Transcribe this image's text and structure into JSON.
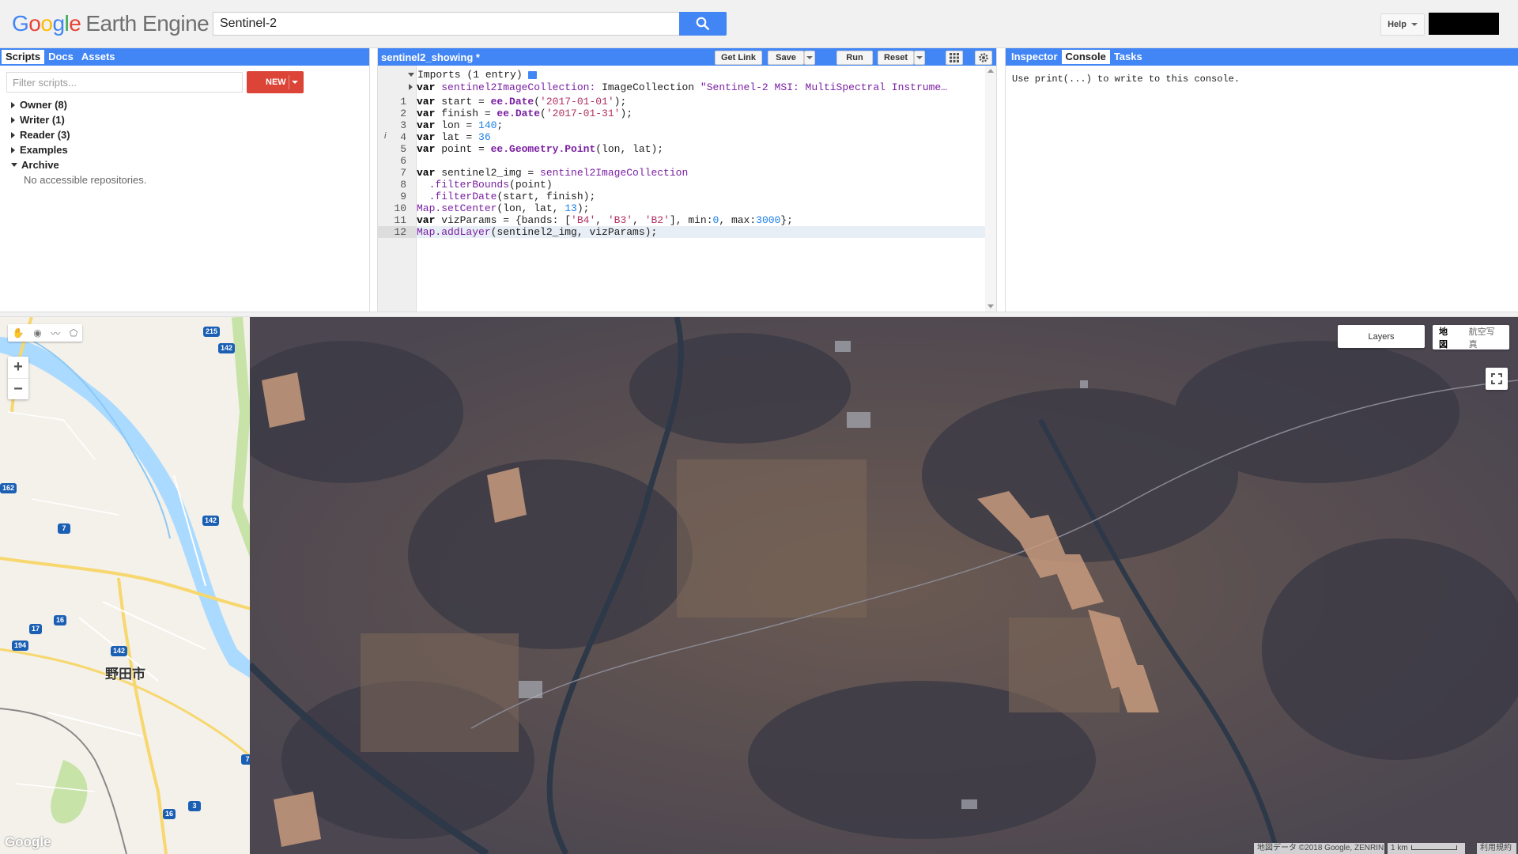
{
  "app": {
    "logo_google": [
      "G",
      "o",
      "o",
      "g",
      "l",
      "e"
    ],
    "logo_rest": "Earth Engine",
    "search_value": "Sentinel-2",
    "help_label": "Help"
  },
  "left_panel": {
    "tabs": [
      "Scripts",
      "Docs",
      "Assets"
    ],
    "filter_placeholder": "Filter scripts...",
    "new_label": "NEW",
    "tree": [
      {
        "label": "Owner  (8)",
        "expanded": false
      },
      {
        "label": "Writer  (1)",
        "expanded": false
      },
      {
        "label": "Reader  (3)",
        "expanded": false
      },
      {
        "label": "Examples",
        "expanded": false
      },
      {
        "label": "Archive",
        "expanded": true
      }
    ],
    "archive_note": "No accessible repositories."
  },
  "code_panel": {
    "title": "sentinel2_showing *",
    "buttons": {
      "get_link": "Get Link",
      "save": "Save",
      "run": "Run",
      "reset": "Reset"
    },
    "imports_label": "Imports (1 entry)",
    "import_var_kw": "var",
    "import_var_name": "sentinel2ImageCollection:",
    "import_type": "ImageCollection",
    "import_desc": "\"Sentinel-2 MSI: MultiSpectral Instrume…",
    "line_numbers": [
      "1",
      "2",
      "3",
      "4",
      "5",
      "6",
      "7",
      "8",
      "9",
      "10",
      "11",
      "12"
    ],
    "lines": {
      "l1": [
        "var",
        " start = ",
        "ee.Date",
        "(",
        "'2017-01-01'",
        ");"
      ],
      "l2": [
        "var",
        " finish = ",
        "ee.Date",
        "(",
        "'2017-01-31'",
        ");"
      ],
      "l3": [
        "var",
        " lon = ",
        "140",
        ";"
      ],
      "l4": [
        "var",
        " lat = ",
        "36"
      ],
      "l5": [
        "var",
        " point = ",
        "ee.Geometry.Point",
        "(lon, lat);"
      ],
      "l7": [
        "var",
        " sentinel2_img = ",
        "sentinel2ImageCollection"
      ],
      "l8": [
        "  ",
        ".filterBounds",
        "(point)"
      ],
      "l9": [
        "  ",
        ".filterDate",
        "(start, finish);"
      ],
      "l10": [
        "Map.setCenter",
        "(lon, lat, ",
        "13",
        ");"
      ],
      "l11": [
        "var",
        " vizParams = {bands: [",
        "'B4'",
        ", ",
        "'B3'",
        ", ",
        "'B2'",
        "], min:",
        "0",
        ", max:",
        "3000",
        "};"
      ],
      "l12": [
        "Map.addLayer",
        "(sentinel2_img, vizParams);"
      ]
    },
    "gutter_marker": "i"
  },
  "right_panel": {
    "tabs": [
      "Inspector",
      "Console",
      "Tasks"
    ],
    "console_text": "Use print(...) to write to this console."
  },
  "map": {
    "layers_label": "Layers",
    "maptype_options": [
      "地図",
      "航空写真"
    ],
    "attribution": "地図データ ©2018 Google, ZENRIN",
    "scale_label": "1 km",
    "terms": "利用規約",
    "google_mark": "Google",
    "city_label": "野田市",
    "shields": [
      "215",
      "142",
      "142",
      "142",
      "16",
      "17",
      "194",
      "7",
      "142",
      "162",
      "3",
      "16",
      "7"
    ],
    "zoom_in": "+",
    "zoom_out": "−",
    "colors": {
      "water": "#aadaff",
      "accent": "#4285f4",
      "new_button": "#db4437"
    }
  }
}
